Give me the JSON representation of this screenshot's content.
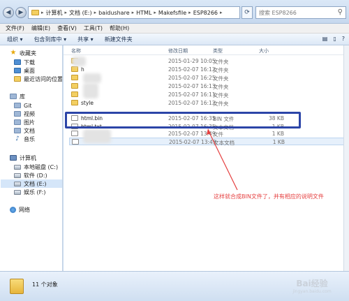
{
  "address": {
    "segments": [
      "计算机",
      "文档 (E:)",
      "baidushare",
      "HTML",
      "Makefsfile",
      "ESP8266"
    ],
    "search_placeholder": "搜索 ESP8266"
  },
  "menu": [
    "文件(F)",
    "编辑(E)",
    "查看(V)",
    "工具(T)",
    "帮助(H)"
  ],
  "toolbar": [
    "组织 ▾",
    "包含到库中 ▾",
    "共享 ▾",
    "新建文件夹"
  ],
  "nav": {
    "favorites": "收藏夹",
    "downloads": "下载",
    "desktop": "桌面",
    "recent": "最近访问的位置",
    "libraries": "库",
    "git": "Git",
    "videos": "视频",
    "pictures": "图片",
    "documents": "文档",
    "music": "音乐",
    "computer": "计算机",
    "drive_c": "本地磁盘 (C:)",
    "drive_d": "软件 (D:)",
    "drive_e": "文档 (E:)",
    "drive_f": "娱乐 (F:)",
    "network": "网络"
  },
  "columns": {
    "name": "名称",
    "date": "修改日期",
    "type": "类型",
    "size": "大小"
  },
  "files": [
    {
      "name": "",
      "date": "2015-01-29 10:05",
      "type": "文件夹",
      "size": "",
      "icon": "folder"
    },
    {
      "name": "h",
      "date": "2015-02-07 16:12",
      "type": "文件夹",
      "size": "",
      "icon": "folder"
    },
    {
      "name": "",
      "date": "2015-02-07 16:25",
      "type": "文件夹",
      "size": "",
      "icon": "folder"
    },
    {
      "name": "",
      "date": "2015-02-07 16:13",
      "type": "文件夹",
      "size": "",
      "icon": "folder"
    },
    {
      "name": "",
      "date": "2015-02-07 16:11",
      "type": "文件夹",
      "size": "",
      "icon": "folder"
    },
    {
      "name": "style",
      "date": "2015-02-07 16:12",
      "type": "文件夹",
      "size": "",
      "icon": "folder"
    },
    {
      "name": "html.bin",
      "date": "2015-02-07 16:35",
      "type": "BIN 文件",
      "size": "38 KB",
      "icon": "file"
    },
    {
      "name": "html.txt",
      "date": "2015-02-07 16:35",
      "type": "文本文档",
      "size": "1 KB",
      "icon": "file"
    },
    {
      "name": "",
      "date": "2015-02-07 13:49",
      "type": "文件",
      "size": "1 KB",
      "icon": "file"
    },
    {
      "name": "",
      "date": "2015-02-07 13:49",
      "type": "文本文档",
      "size": "1 KB",
      "icon": "file"
    }
  ],
  "annotation": "这样就合成BIN文件了，并有相应的说明文件",
  "status": {
    "count": "11 个对象"
  },
  "watermark": {
    "main": "Bai经验",
    "sub": "jingyan.baidu.com"
  },
  "colors": {
    "highlight": "#2c45a8",
    "annotation": "#e53f3f"
  }
}
